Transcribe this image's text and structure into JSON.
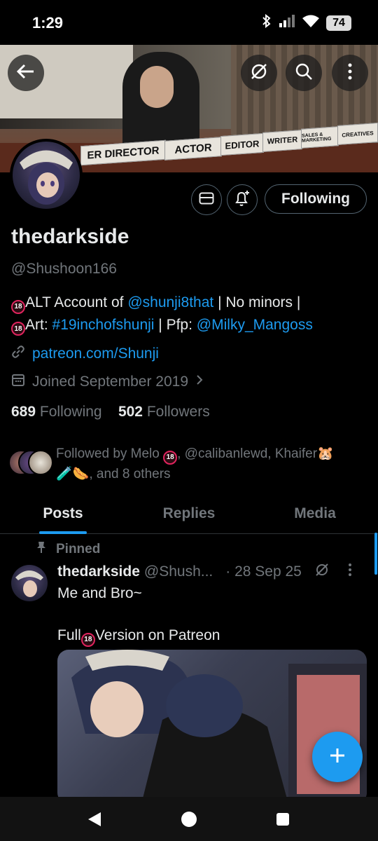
{
  "status_bar": {
    "time": "1:29",
    "battery": "74",
    "icons": [
      "bluetooth-icon",
      "signal-icon",
      "wifi-icon",
      "battery-icon"
    ]
  },
  "banner": {
    "plaques": [
      "ER DIRECTOR",
      "ACTOR",
      "EDITOR",
      "WRITER",
      "SALES & MARKETING",
      "CREATIVES"
    ]
  },
  "profile": {
    "display_name": "thedarkside",
    "handle": "@Shushoon166",
    "bio_line1_prefix": "ALT Account of ",
    "bio_line1_mention": "@shunji8that",
    "bio_line1_suffix": " | No minors |",
    "bio_line2_prefix": "Art: ",
    "bio_line2_hashtag": "#19inchofshunji",
    "bio_line2_mid": " | Pfp: ",
    "bio_line2_mention": "@Milky_Mangoss",
    "badge": "18",
    "website": "patreon.com/Shunji",
    "joined": "Joined September 2019",
    "following_count": "689",
    "following_label": "Following",
    "followers_count": "502",
    "followers_label": "Followers",
    "followed_by_line1": "Followed by Melo",
    "followed_by_line1b": ", @calibanlewd, Khaifer",
    "followed_by_line2": ", and 8 others",
    "follow_button": "Following"
  },
  "tabs": [
    {
      "label": "Posts",
      "active": true
    },
    {
      "label": "Replies",
      "active": false
    },
    {
      "label": "Media",
      "active": false
    }
  ],
  "post": {
    "pinned_label": "Pinned",
    "author": "thedarkside",
    "handle": "@Shush...",
    "date": "· 28 Sep 25",
    "line1": "Me and Bro~",
    "line2_prefix": "Full",
    "line2_suffix": "Version on Patreon"
  },
  "colors": {
    "accent": "#1d9bf0",
    "text": "#e7e9ea",
    "muted": "#71767b",
    "background": "#000000"
  }
}
